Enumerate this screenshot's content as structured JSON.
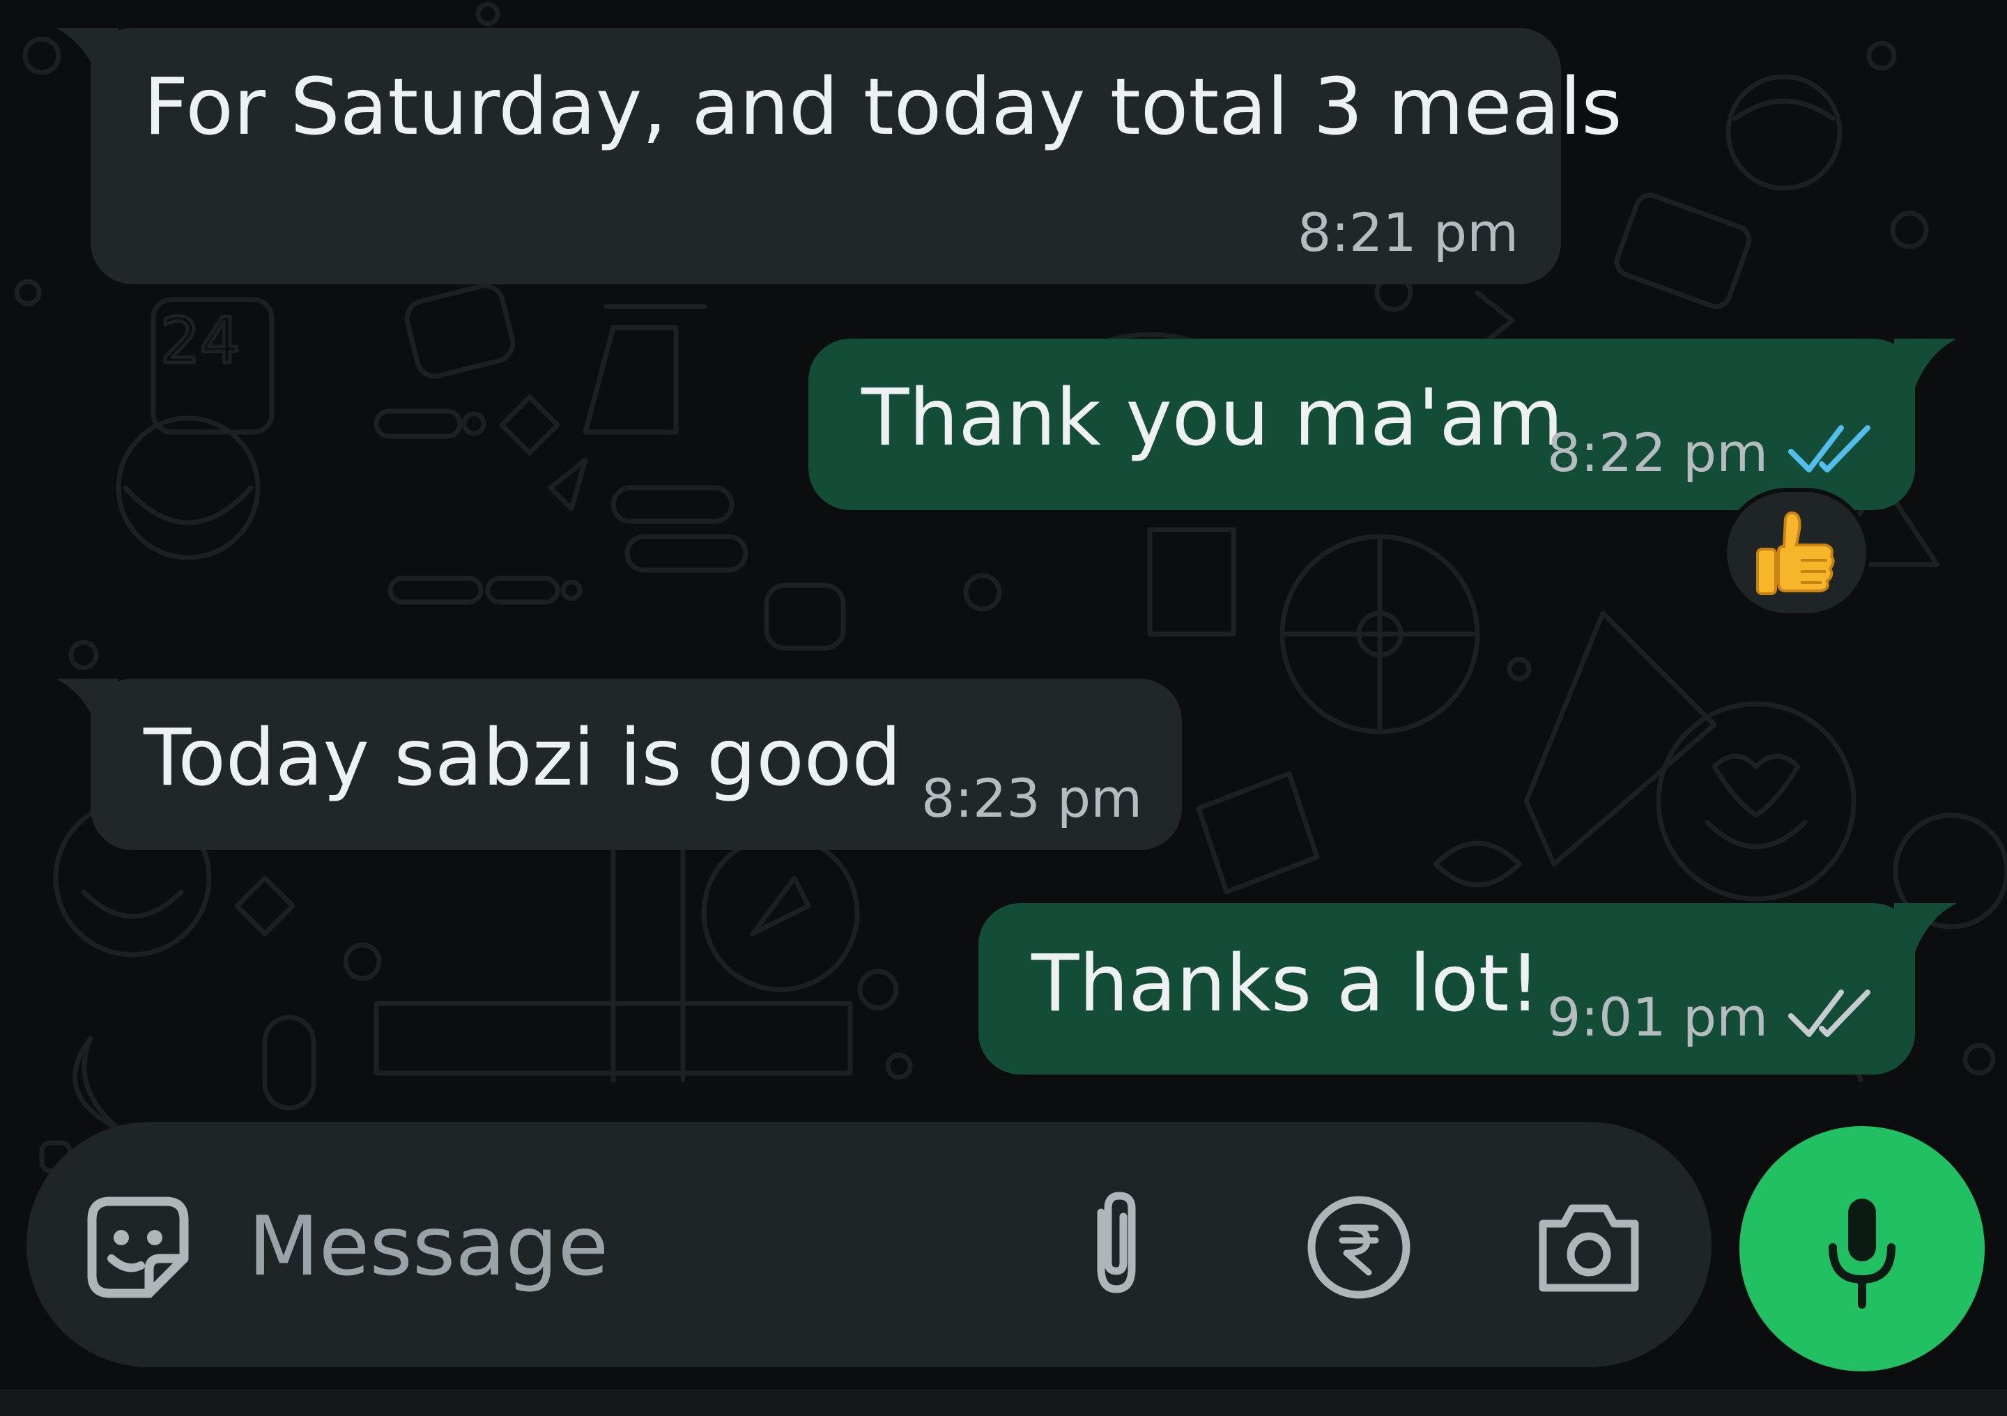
{
  "messages": [
    {
      "direction": "incoming",
      "text": "For Saturday, and today total 3 meals",
      "time": "8:21 pm"
    },
    {
      "direction": "outgoing",
      "text": "Thank you ma'am",
      "time": "8:22 pm",
      "status": "read",
      "reaction": "👍"
    },
    {
      "direction": "incoming",
      "text": "Today sabzi is good",
      "time": "8:23 pm"
    },
    {
      "direction": "outgoing",
      "text": "Thanks a lot!",
      "time": "9:01 pm",
      "status": "delivered"
    }
  ],
  "composer": {
    "placeholder": "Message",
    "icons": {
      "sticker": "sticker-icon",
      "attach": "paperclip-icon",
      "payment": "rupee-icon",
      "camera": "camera-icon",
      "mic": "microphone-icon"
    }
  },
  "colors": {
    "background": "#0b0d0e",
    "incoming_bubble": "#212628",
    "outgoing_bubble": "#134d37",
    "read_tick": "#53bdeb",
    "delivered_tick": "#c6cdd0",
    "mic_button": "#21c063"
  }
}
